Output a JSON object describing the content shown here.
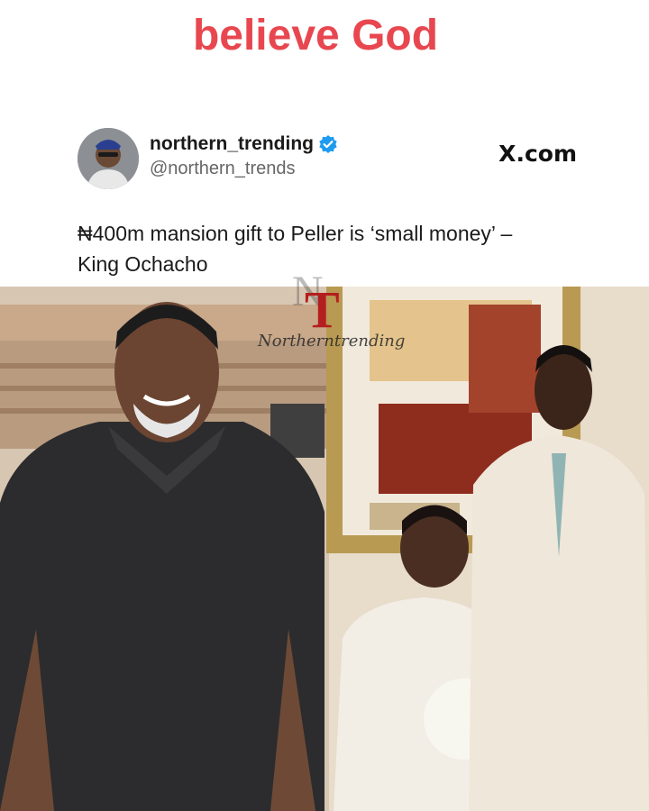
{
  "caption": "believe God",
  "post": {
    "display_name": "northern_trending",
    "handle": "@northern_trends",
    "site": "X.com",
    "headline_line1": "₦400m mansion gift to Peller is ‘small money’ –",
    "headline_line2": "King Ochacho"
  },
  "watermark": {
    "text": "Northerntrending"
  },
  "icons": {
    "verified": "verified-badge-icon",
    "site_logo": "x-logo"
  },
  "colors": {
    "caption": "#e8474f",
    "verified": "#1d9bf0",
    "watermark_t": "#b41e1e"
  }
}
